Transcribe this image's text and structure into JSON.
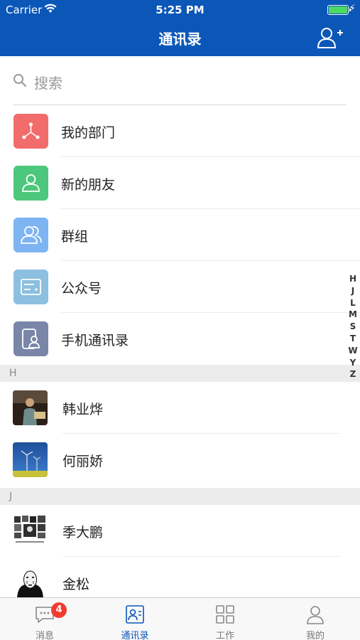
{
  "status_bar": {
    "carrier": "Carrier",
    "wifi_icon": "wifi-icon",
    "time": "5:25 PM",
    "battery_level": 1.0,
    "charging_icon": "bolt-icon"
  },
  "nav": {
    "title": "通讯录",
    "add_icon": "add-contact-icon",
    "bar_color": "#0B57B8"
  },
  "search": {
    "placeholder": "搜索",
    "icon": "search-icon"
  },
  "features": [
    {
      "label": "我的部门",
      "icon": "department-icon",
      "color": "#F36C6C"
    },
    {
      "label": "新的朋友",
      "icon": "person-icon",
      "color": "#4CC77B"
    },
    {
      "label": "群组",
      "icon": "group-icon",
      "color": "#7EB4F2"
    },
    {
      "label": "公众号",
      "icon": "official-account-icon",
      "color": "#8CBFE0"
    },
    {
      "label": "手机通讯录",
      "icon": "phone-contacts-icon",
      "color": "#7A86A8"
    }
  ],
  "sections": [
    {
      "letter": "H",
      "contacts": [
        {
          "name": "韩业烨",
          "avatar": "photo-avatar"
        },
        {
          "name": "何丽娇",
          "avatar": "windmill-avatar"
        }
      ]
    },
    {
      "letter": "J",
      "contacts": [
        {
          "name": "季大鹏",
          "avatar": "collage-avatar"
        },
        {
          "name": "金松",
          "avatar": "noface-avatar"
        }
      ]
    }
  ],
  "index_letters": [
    "H",
    "J",
    "L",
    "M",
    "S",
    "T",
    "W",
    "Y",
    "Z"
  ],
  "tabs": [
    {
      "label": "消息",
      "icon": "message-icon",
      "badge": "4",
      "active": false
    },
    {
      "label": "通讯录",
      "icon": "contacts-icon",
      "badge": "",
      "active": true
    },
    {
      "label": "工作",
      "icon": "grid-icon",
      "badge": "",
      "active": false
    },
    {
      "label": "我的",
      "icon": "profile-icon",
      "badge": "",
      "active": false
    }
  ],
  "accent_color": "#0B57B8",
  "badge_color": "#F23B30"
}
